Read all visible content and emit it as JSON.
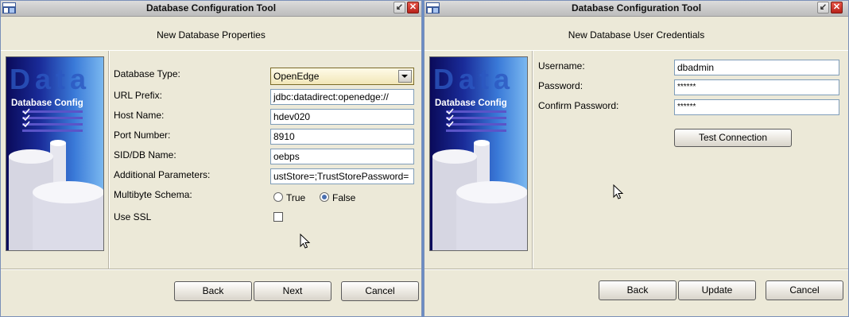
{
  "window1": {
    "title": "Database Configuration Tool",
    "header": "New Database Properties",
    "sidebar_image": {
      "logo_text": "Data",
      "caption": "Database Config"
    },
    "form": {
      "database_type_label": "Database Type:",
      "database_type_value": "OpenEdge",
      "url_prefix_label": "URL Prefix:",
      "url_prefix_value": "jdbc:datadirect:openedge://",
      "host_name_label": "Host Name:",
      "host_name_value": "hdev020",
      "port_number_label": "Port Number:",
      "port_number_value": "8910",
      "sid_label": "SID/DB Name:",
      "sid_value": "oebps",
      "additional_params_label": "Additional Parameters:",
      "additional_params_value": "ustStore=;TrustStorePassword=",
      "multibyte_label": "Multibyte Schema:",
      "multibyte_true": "True",
      "multibyte_false": "False",
      "multibyte_selected": "False",
      "use_ssl_label": "Use SSL",
      "use_ssl_checked": false
    },
    "buttons": {
      "back": "Back",
      "next": "Next",
      "cancel": "Cancel"
    }
  },
  "window2": {
    "title": "Database Configuration Tool",
    "header": "New Database User Credentials",
    "sidebar_image": {
      "logo_text": "Data",
      "caption": "Database Config"
    },
    "form": {
      "username_label": "Username:",
      "username_value": "dbadmin",
      "password_label": "Password:",
      "password_value": "******",
      "confirm_password_label": "Confirm Password:",
      "confirm_password_value": "******",
      "test_connection": "Test Connection"
    },
    "buttons": {
      "back": "Back",
      "update": "Update",
      "cancel": "Cancel"
    }
  },
  "colors": {
    "window_bg": "#ece9d8",
    "close_button": "#c8302a",
    "combo_bg": "#f4ecc8",
    "field_border": "#7f9db9"
  }
}
